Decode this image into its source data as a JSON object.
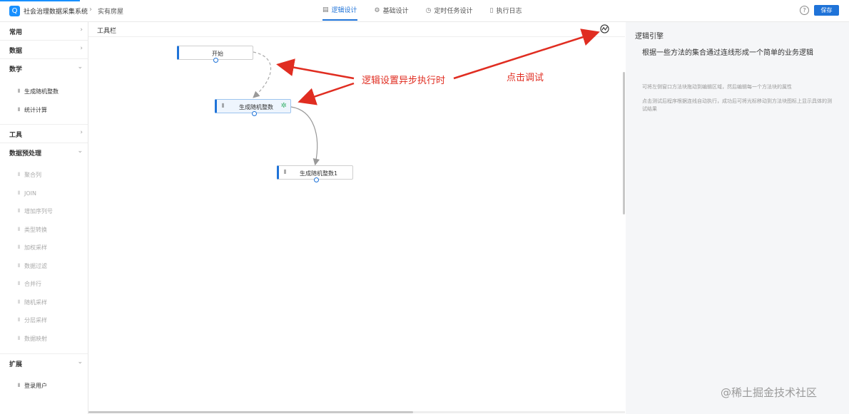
{
  "header": {
    "logo_glyph": "Q",
    "app_title": "社会治理数据采集系统",
    "breadcrumb_sep": "›",
    "breadcrumb": "实有房屋",
    "tabs": [
      {
        "label": "逻辑设计",
        "icon": "▤",
        "icon_name": "design-icon"
      },
      {
        "label": "基础设计",
        "icon": "⚙",
        "icon_name": "gear-icon"
      },
      {
        "label": "定时任务设计",
        "icon": "◷",
        "icon_name": "clock-icon"
      },
      {
        "label": "执行日志",
        "icon": "▯",
        "icon_name": "log-icon"
      }
    ],
    "help_glyph": "?",
    "save_label": "保存",
    "accent_color": "#1f73d8"
  },
  "sidebar": {
    "categories": [
      {
        "label": "常用",
        "chevron": "›"
      },
      {
        "label": "数据",
        "chevron": "›"
      },
      {
        "label": "数学",
        "chevron": "⌄"
      },
      {
        "label": "工具",
        "chevron": "›"
      },
      {
        "label": "数据预处理",
        "chevron": "⌄"
      },
      {
        "label": "扩展",
        "chevron": "⌄"
      }
    ],
    "math_items": [
      "生成随机整数",
      "统计计算"
    ],
    "preprocess_items": [
      "聚合列",
      "JOIN",
      "增加序列号",
      "类型转换",
      "加权采样",
      "数据过滤",
      "合并行",
      "随机采样",
      "分层采样",
      "数据映射"
    ],
    "ext_items": [
      "登录用户"
    ],
    "item_icon": "⫴"
  },
  "canvas": {
    "toolbar_label": "工具栏",
    "nodes": [
      {
        "label": "开始"
      },
      {
        "label": "生成随机整数",
        "icon": "⫴"
      },
      {
        "label": "生成随机整数1",
        "icon": "⫴"
      }
    ],
    "running_glyph": "✲"
  },
  "annotations": {
    "async_note": "逻辑设置异步执行时",
    "debug_note": "点击调试",
    "color": "#e02d21"
  },
  "panel": {
    "title": "逻辑引擎",
    "description": "根据一些方法的集合通过连线形成一个简单的业务逻辑",
    "note1": "可将左侧窗口方法块拖动到编辑区域，然后编辑每一个方法块的属性",
    "note2": "点击测试后程序根据连线自动执行，成功后可将光标移动到方法块图标上显示具体的测试结果"
  },
  "watermark": "@稀土掘金技术社区"
}
